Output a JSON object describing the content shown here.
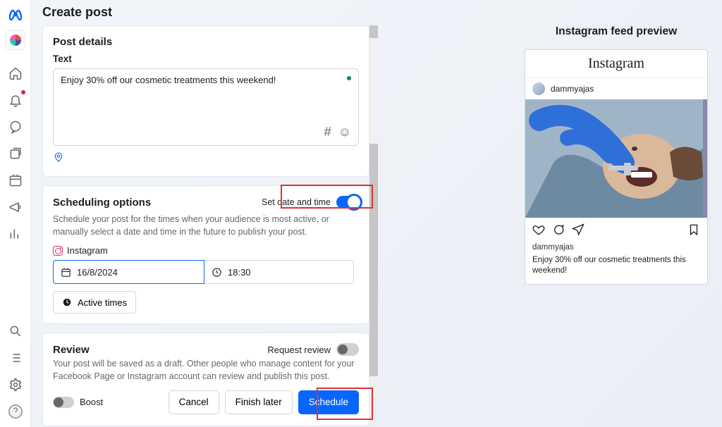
{
  "page_title": "Create post",
  "post_details": {
    "heading": "Post details",
    "text_label": "Text",
    "text_value": "Enjoy 30% off our cosmetic treatments this weekend!"
  },
  "scheduling": {
    "heading": "Scheduling options",
    "toggle_label": "Set date and time",
    "description": "Schedule your post for the times when your audience is most active, or manually select a date and time in the future to publish your post.",
    "platform_label": "Instagram",
    "date_value": "16/8/2024",
    "time_value": "18:30",
    "active_times_label": "Active times"
  },
  "review": {
    "heading": "Review",
    "request_label": "Request review",
    "description": "Your post will be saved as a draft. Other people who manage content for your Facebook Page or Instagram account can review and publish this post."
  },
  "boost_label": "Boost",
  "buttons": {
    "cancel": "Cancel",
    "finish_later": "Finish later",
    "schedule": "Schedule"
  },
  "preview": {
    "heading": "Instagram feed preview",
    "brand": "Instagram",
    "username": "dammyajas",
    "caption": "Enjoy 30% off our cosmetic treatments this weekend!"
  }
}
